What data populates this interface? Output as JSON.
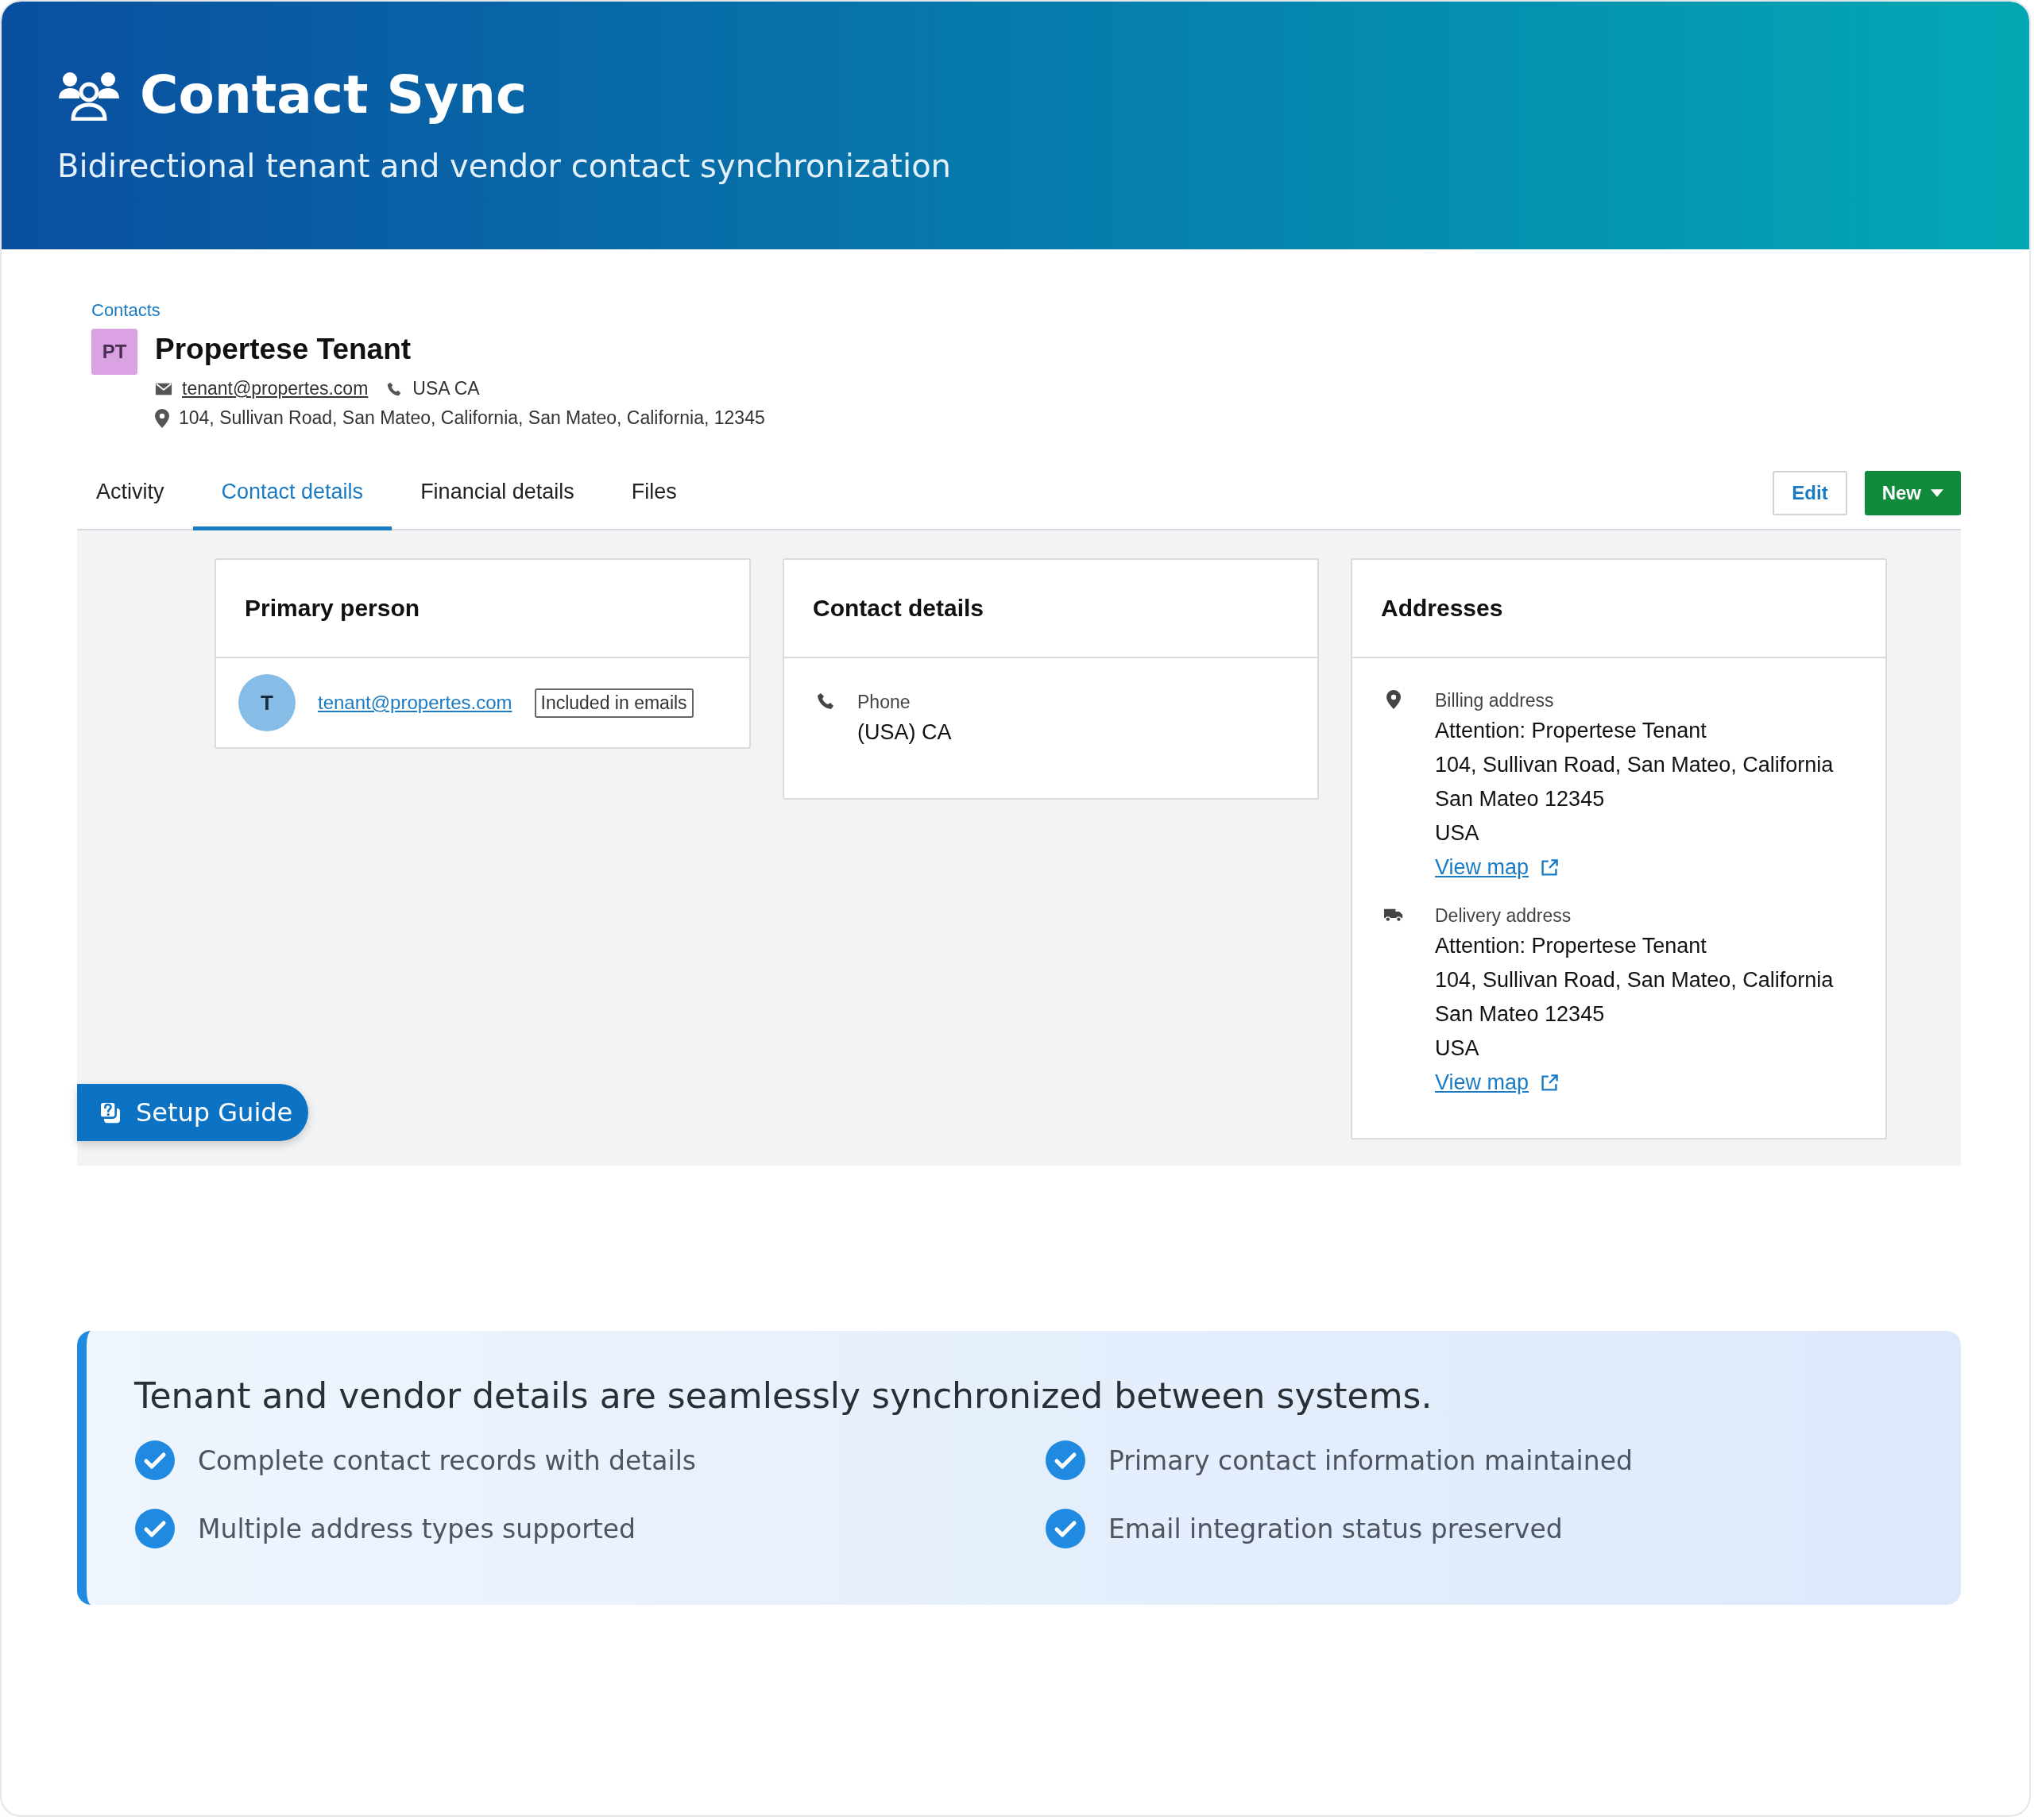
{
  "header": {
    "title": "Contact Sync",
    "subtitle": "Bidirectional tenant and vendor contact synchronization"
  },
  "contact": {
    "breadcrumb": "Contacts",
    "initials": "PT",
    "name": "Propertese Tenant",
    "email": "tenant@propertes.com",
    "phone": "USA CA",
    "address": "104, Sullivan Road, San Mateo, California, San Mateo, California, 12345"
  },
  "tabs": [
    {
      "label": "Activity",
      "selected": false
    },
    {
      "label": "Contact details",
      "selected": true
    },
    {
      "label": "Financial details",
      "selected": false
    },
    {
      "label": "Files",
      "selected": false
    }
  ],
  "actions": {
    "edit": "Edit",
    "new": "New"
  },
  "primary_person": {
    "title": "Primary person",
    "initial": "T",
    "email": "tenant@propertes.com",
    "badge": "Included in emails"
  },
  "contact_details": {
    "title": "Contact details",
    "label": "Phone",
    "value": "(USA) CA"
  },
  "addresses": {
    "title": "Addresses",
    "items": [
      {
        "kind": "billing",
        "label": "Billing address",
        "lines": [
          "Attention: Propertese Tenant",
          "104, Sullivan Road, San Mateo, California",
          "San Mateo 12345",
          "USA"
        ],
        "link": "View map"
      },
      {
        "kind": "delivery",
        "label": "Delivery address",
        "lines": [
          "Attention: Propertese Tenant",
          "104, Sullivan Road, San Mateo, California",
          "San Mateo 12345",
          "USA"
        ],
        "link": "View map"
      }
    ]
  },
  "setup_guide": {
    "label": "Setup Guide"
  },
  "summary": {
    "title": "Tenant and vendor details are seamlessly synchronized between systems.",
    "features": [
      "Complete contact records with details",
      "Primary contact information maintained",
      "Multiple address types supported",
      "Email integration status preserved"
    ]
  }
}
